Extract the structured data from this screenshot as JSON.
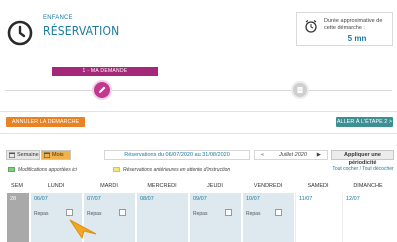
{
  "header": {
    "subtitle": "ENFANCE",
    "title": "RÉSERVATION"
  },
  "duration": {
    "label": "Durée approximative de cette démarche :",
    "value": "5 mn"
  },
  "stepper": {
    "current_step_label": "1 - MA DEMANDE"
  },
  "actions": {
    "cancel_label": "ANNULER LA DEMARCHE",
    "next_label": "ALLER À L'ÉTAPE 2 >"
  },
  "toolbar": {
    "week_label": "Semaine",
    "month_label": "Mois",
    "range_label": "Réservations du 06/07/2020 au 31/08/2020",
    "prev_arrow": "«",
    "month_label_current": "Juillet 2020",
    "next_arrow": "▶",
    "periodicity_label": "Appliquer une périodicité"
  },
  "legend": {
    "green_label": "Modifications apportées ici",
    "yellow_label": "Réservations antérieures en attente d'instruction",
    "check_all": "Tout cocher",
    "separator": "/",
    "uncheck_all": "Tout décocher"
  },
  "colors": {
    "brand_blue": "#1a7aa0",
    "step_active": "#c2378f",
    "cancel_orange": "#e98223",
    "next_teal": "#3d8f93"
  },
  "calendar": {
    "headers": [
      "SEM",
      "LUNDI",
      "MARDI",
      "MERCREDI",
      "JEUDI",
      "VENDREDI",
      "SAMEDI",
      "DIMANCHE"
    ],
    "week_number": "28",
    "days": [
      {
        "date": "06/07",
        "repas": "Repas",
        "has_checkbox": true
      },
      {
        "date": "07/07",
        "repas": "Repas",
        "has_checkbox": true
      },
      {
        "date": "08/07",
        "repas": "",
        "has_checkbox": false
      },
      {
        "date": "09/07",
        "repas": "Repas",
        "has_checkbox": true
      },
      {
        "date": "10/07",
        "repas": "Repas",
        "has_checkbox": true
      },
      {
        "date": "11/07",
        "repas": "",
        "has_checkbox": false
      },
      {
        "date": "12/07",
        "repas": "",
        "has_checkbox": false
      }
    ]
  }
}
